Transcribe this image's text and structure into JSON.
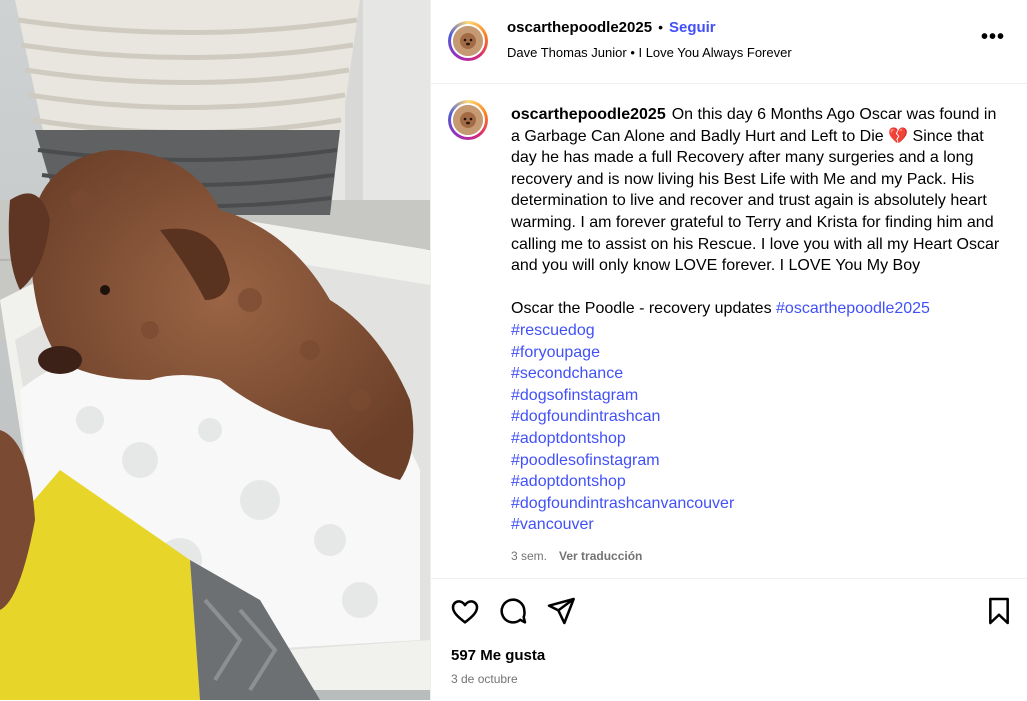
{
  "header": {
    "username": "oscarthepoodle2025",
    "dot": "•",
    "follow_label": "Seguir",
    "subline": "Dave Thomas Junior • I Love You Always Forever",
    "more_icon": "more-horizontal-icon",
    "more_glyph": "•••"
  },
  "caption": {
    "username": "oscarthepoodle2025",
    "text_part1": "On this day 6 Months Ago Oscar was found in a Garbage Can Alone and Badly Hurt and Left to Die",
    "heart": "💔",
    "text_part2": "Since that day he has made a full Recovery after many surgeries and a long recovery and is now living his Best Life with Me and my Pack. His determination to live and recover and trust again is absolutely heart warming. I am forever grateful to Terry and Krista for finding him and calling me to assist on his Rescue. I love you with all my Heart Oscar and you will only know LOVE forever. I LOVE You My Boy",
    "line2": "Oscar the Poodle - recovery updates",
    "first_tag": "#oscarthepoodle2025",
    "tags": [
      "#rescuedog",
      "#foryoupage",
      "#secondchance",
      "#dogsofinstagram",
      "#dogfoundintrashcan",
      "#adoptdontshop",
      "#poodlesofinstagram",
      "#adoptdontshop",
      "#dogfoundintrashcanvancouver",
      "#vancouver"
    ],
    "age": "3 sem.",
    "translate": "Ver traducción"
  },
  "actions": {
    "like_icon": "heart-icon",
    "comment_icon": "comment-icon",
    "share_icon": "share-icon",
    "save_icon": "bookmark-icon"
  },
  "likes": "597 Me gusta",
  "date": "3 de octubre",
  "colors": {
    "link": "#4150f7",
    "muted": "#737373",
    "divider": "#efefef"
  }
}
